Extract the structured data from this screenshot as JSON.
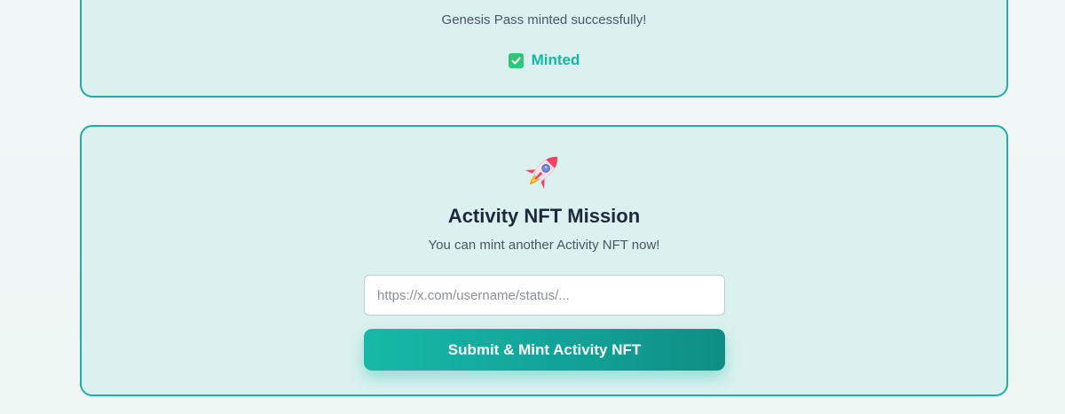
{
  "genesis_card": {
    "message": "Genesis Pass minted successfully!",
    "status_label": "Minted",
    "status_icon": "check-icon"
  },
  "mission_card": {
    "icon": "rocket-icon",
    "title": "Activity NFT Mission",
    "subtitle": "You can mint another Activity NFT now!",
    "url_input": {
      "value": "",
      "placeholder": "https://x.com/username/status/..."
    },
    "submit_label": "Submit & Mint Activity NFT"
  },
  "colors": {
    "accent": "#16b5a4",
    "card_border": "#22ada4",
    "card_background": "#daf1ef",
    "title": "#1e293b",
    "check": "#33c47a"
  }
}
